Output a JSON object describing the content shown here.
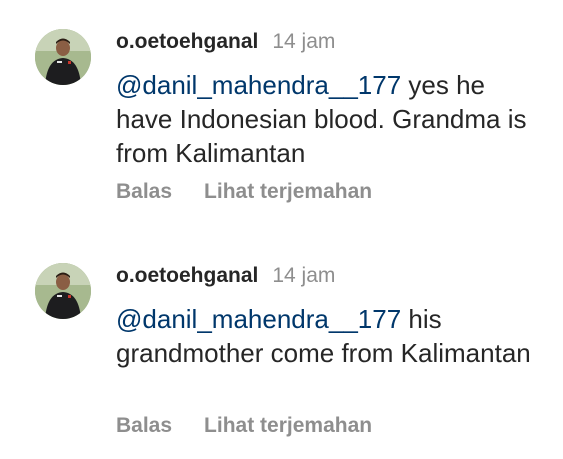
{
  "comments": [
    {
      "username": "o.oetoehganal",
      "timestamp": "14 jam",
      "mention": "@danil_mahendra__177",
      "text": " yes he have Indonesian blood. Grandma is from Kalimantan",
      "reply_label": "Balas",
      "translate_label": "Lihat terjemahan"
    },
    {
      "username": "o.oetoehganal",
      "timestamp": "14 jam",
      "mention": "@danil_mahendra__177",
      "text": " his grandmother come from Kalimantan",
      "reply_label": "Balas",
      "translate_label": "Lihat terjemahan"
    }
  ],
  "colors": {
    "mention": "#00376b",
    "text": "#262626",
    "muted": "#8e8e8e"
  }
}
